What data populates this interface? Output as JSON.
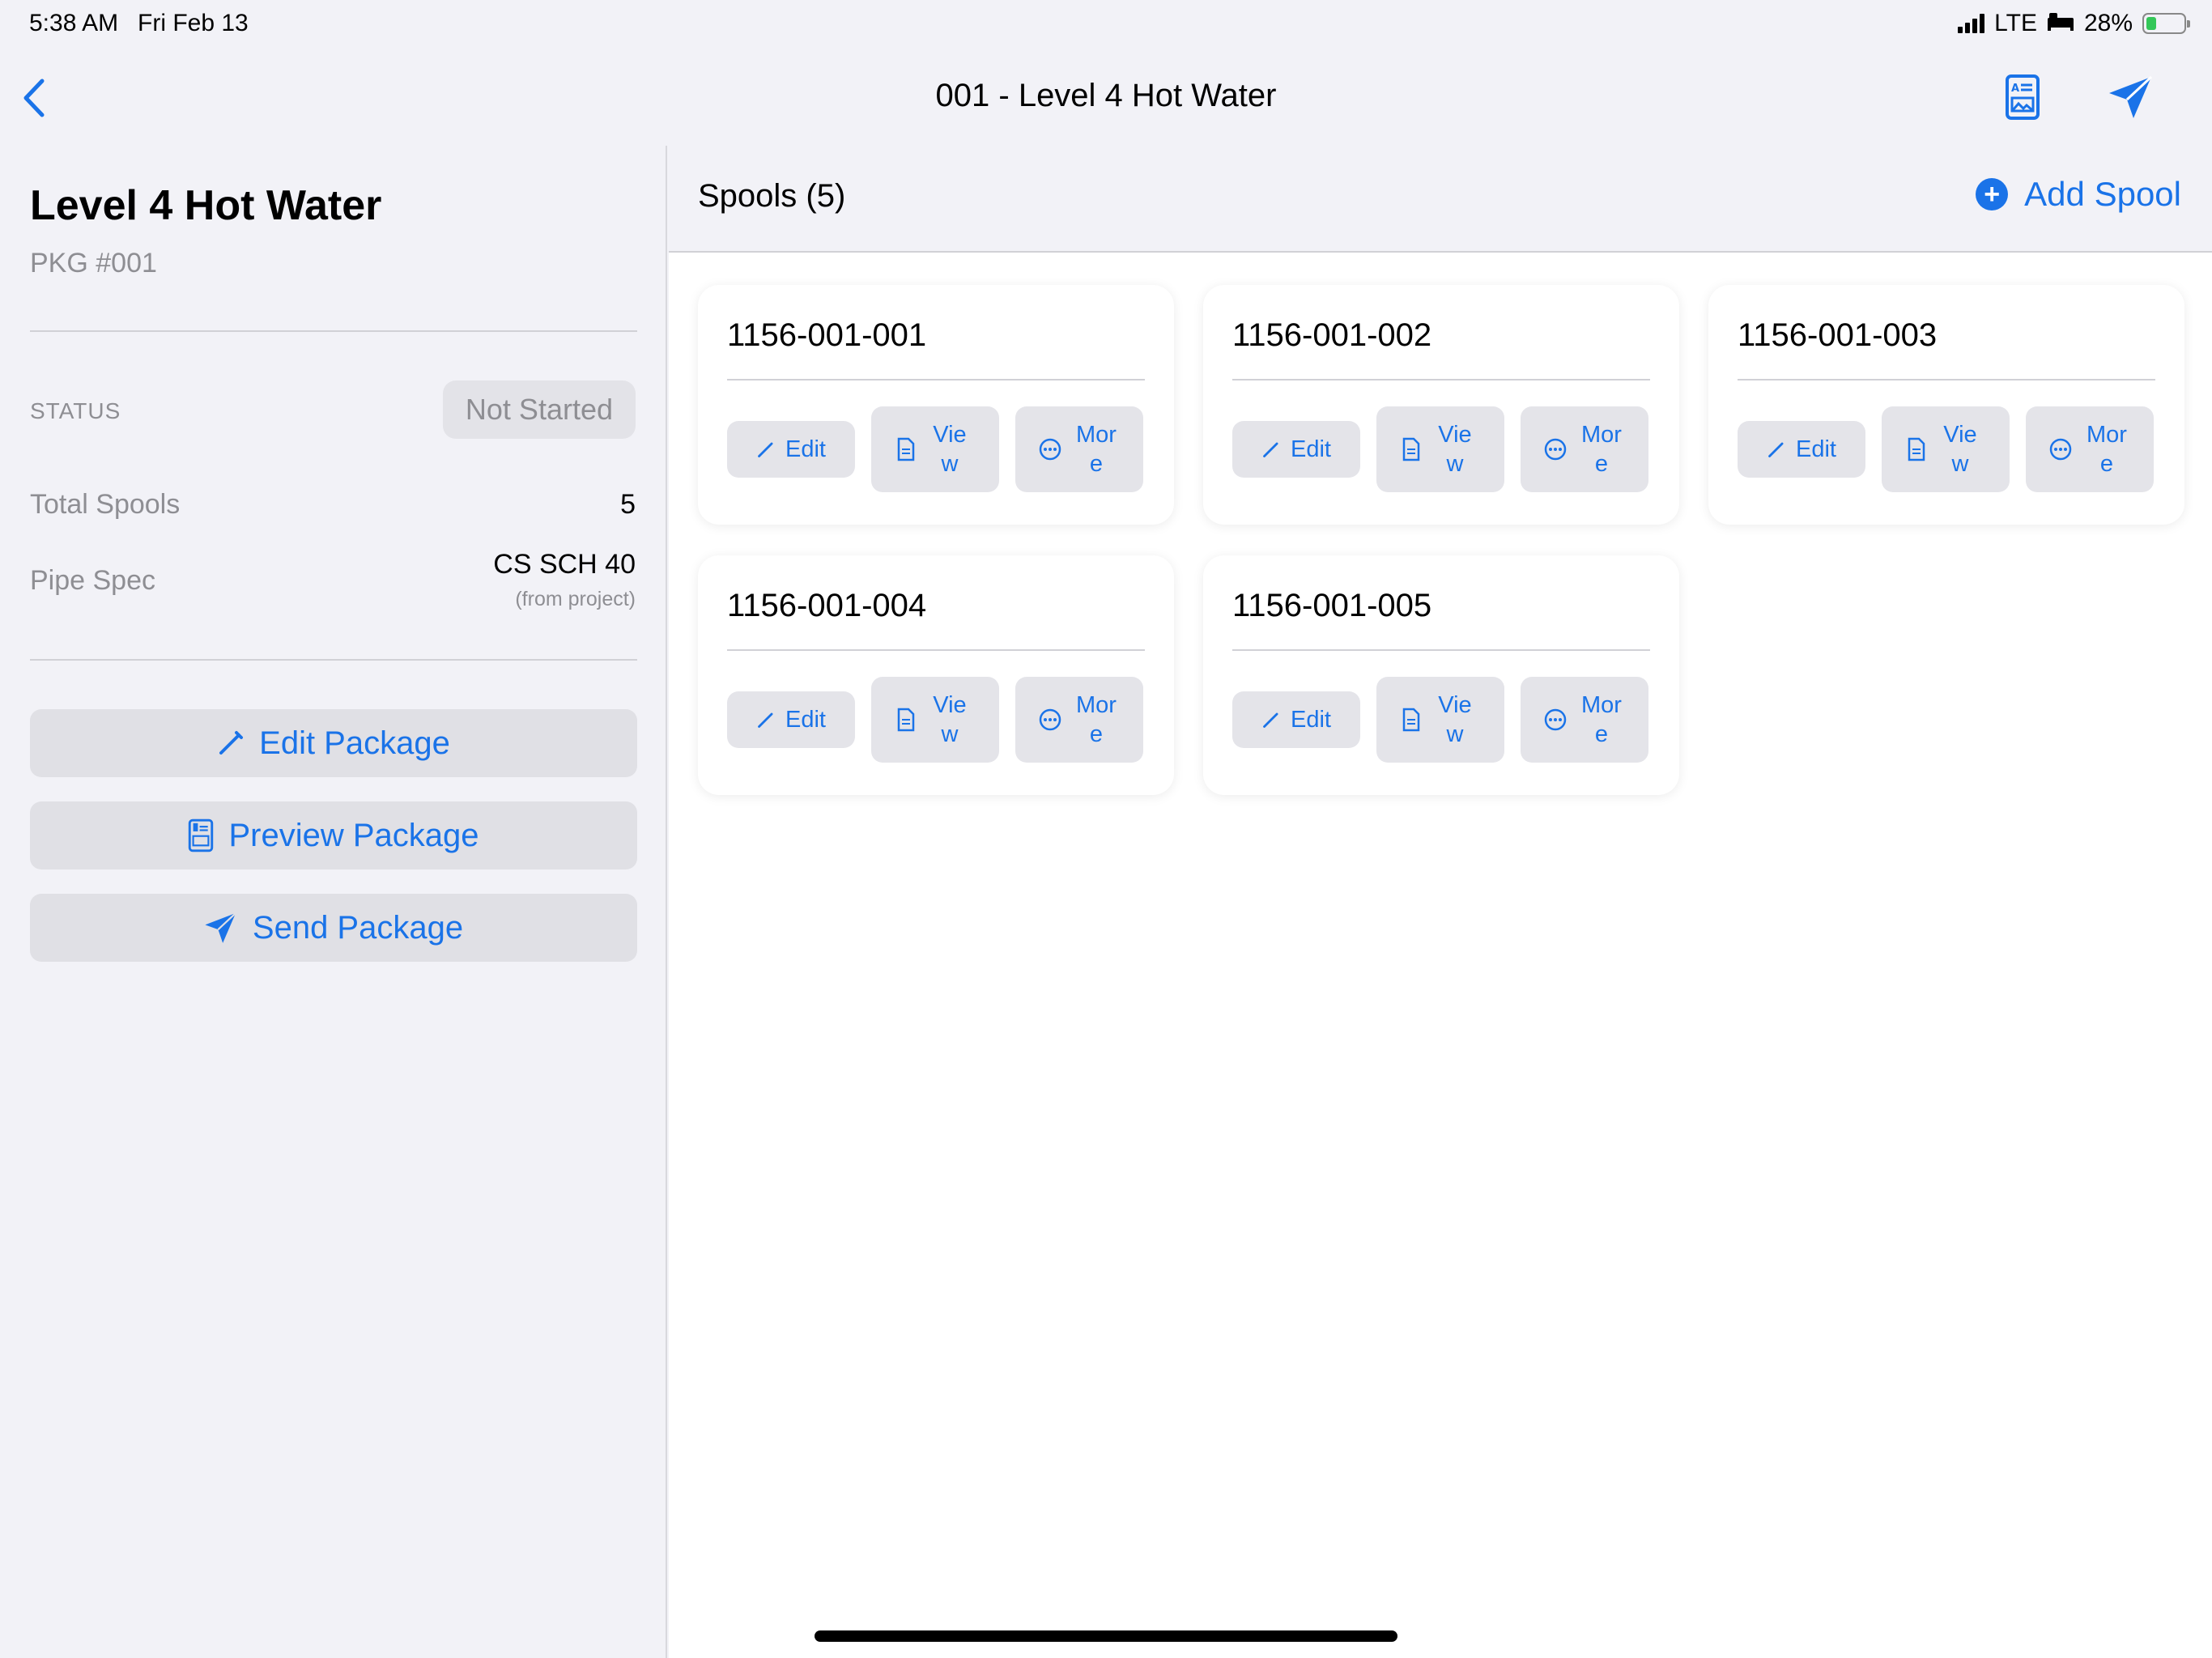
{
  "status_bar": {
    "time": "5:38 AM",
    "date": "Fri Feb 13",
    "network": "LTE",
    "battery": "28%",
    "battery_level": 0.28
  },
  "nav": {
    "title": "001 - Level 4 Hot Water",
    "back_icon": "chevron-left-icon",
    "preview_icon": "document-preview-icon",
    "send_icon": "paper-plane-icon"
  },
  "sidebar": {
    "title": "Level 4 Hot Water",
    "pkg_number": "PKG #001",
    "status_label": "STATUS",
    "status_value": "Not Started",
    "total_spools_label": "Total Spools",
    "total_spools_value": "5",
    "pipe_spec_label": "Pipe Spec",
    "pipe_spec_value": "CS SCH 40",
    "pipe_spec_note": "(from project)",
    "buttons": {
      "edit": "Edit Package",
      "preview": "Preview Package",
      "send": "Send Package"
    }
  },
  "main": {
    "spools_title": "Spools (5)",
    "add_spool": "Add Spool",
    "spools": [
      {
        "id": "1156-001-001",
        "edit": "Edit",
        "view": "View",
        "more": "More"
      },
      {
        "id": "1156-001-002",
        "edit": "Edit",
        "view": "View",
        "more": "More"
      },
      {
        "id": "1156-001-003",
        "edit": "Edit",
        "view": "View",
        "more": "More"
      },
      {
        "id": "1156-001-004",
        "edit": "Edit",
        "view": "View",
        "more": "More"
      },
      {
        "id": "1156-001-005",
        "edit": "Edit",
        "view": "View",
        "more": "More"
      }
    ]
  },
  "colors": {
    "accent": "#1a73e8",
    "background": "#f2f2f7",
    "button_bg": "#e0e0e5",
    "secondary_text": "#8e8e93"
  }
}
